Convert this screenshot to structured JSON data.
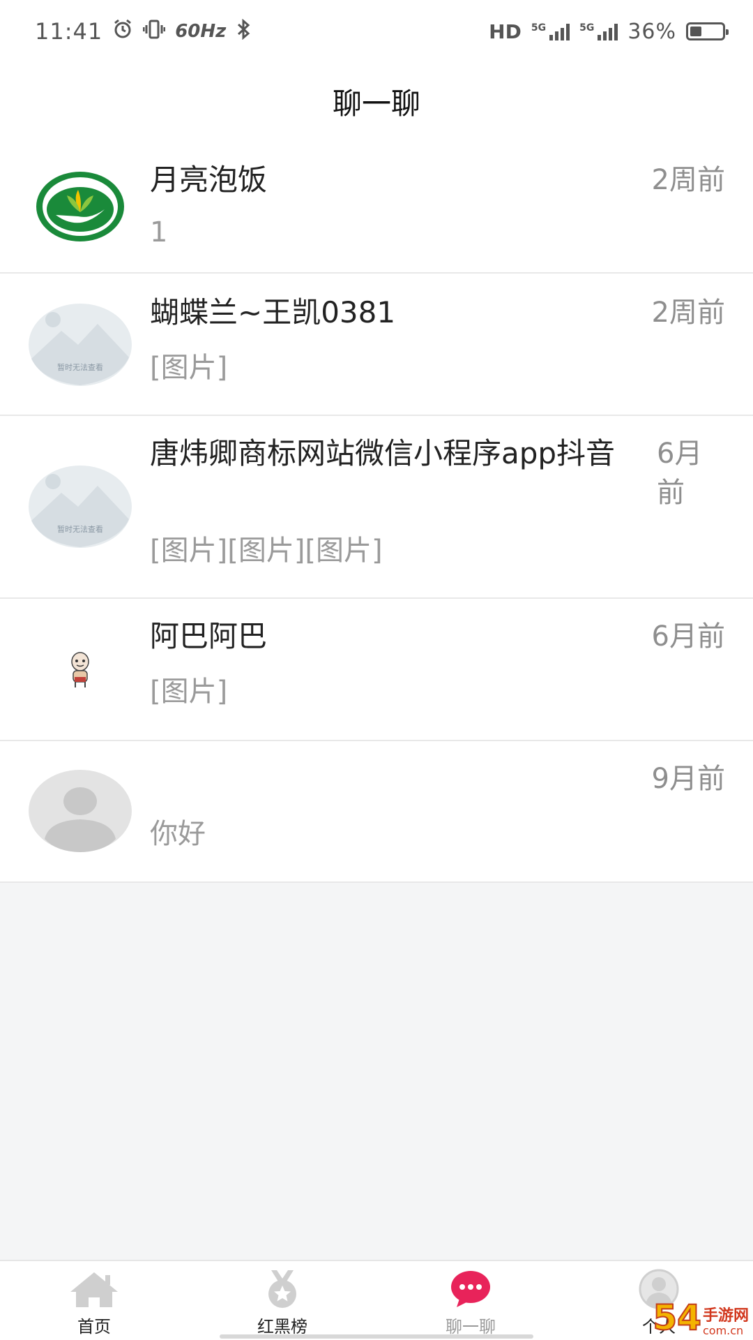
{
  "status_bar": {
    "time": "11:41",
    "refresh_rate": "60Hz",
    "hd_label": "HD",
    "network_1": "5G",
    "network_2": "5G",
    "battery": "36%"
  },
  "header": {
    "title": "聊一聊"
  },
  "chats": [
    {
      "name": "月亮泡饭",
      "message": "1",
      "time": "2周前"
    },
    {
      "name": "蝴蝶兰~王凯0381",
      "message": "[图片]",
      "time": "2周前",
      "avatar_text": "暂时无法查看"
    },
    {
      "name": "唐炜卿商标网站微信小程序app抖音",
      "message": "[图片][图片][图片]",
      "time": "6月前",
      "avatar_text": "暂时无法查看"
    },
    {
      "name": "阿巴阿巴",
      "message": "[图片]",
      "time": "6月前"
    },
    {
      "name": "",
      "message": "你好",
      "time": "9月前"
    }
  ],
  "tabbar": {
    "tabs": [
      {
        "label": "首页",
        "icon": "home-icon"
      },
      {
        "label": "红黑榜",
        "icon": "medal-icon"
      },
      {
        "label": "聊一聊",
        "icon": "chat-icon",
        "active": true
      },
      {
        "label": "个人",
        "icon": "user-icon"
      }
    ]
  },
  "watermark": {
    "number": "54",
    "brand": "手游网",
    "url": "com.cn"
  },
  "colors": {
    "active_tab": "#e8235a",
    "time_gray": "#8e8e8e",
    "message_gray": "#9a9a9a",
    "logo_green": "#1a8a3a"
  }
}
